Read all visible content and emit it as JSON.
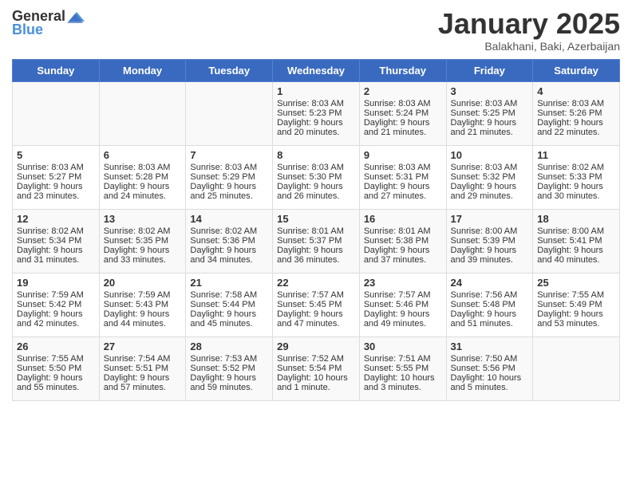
{
  "header": {
    "logo_general": "General",
    "logo_blue": "Blue",
    "month": "January 2025",
    "location": "Balakhani, Baki, Azerbaijan"
  },
  "days_of_week": [
    "Sunday",
    "Monday",
    "Tuesday",
    "Wednesday",
    "Thursday",
    "Friday",
    "Saturday"
  ],
  "weeks": [
    [
      {
        "day": "",
        "info": ""
      },
      {
        "day": "",
        "info": ""
      },
      {
        "day": "",
        "info": ""
      },
      {
        "day": "1",
        "info": "Sunrise: 8:03 AM\nSunset: 5:23 PM\nDaylight: 9 hours\nand 20 minutes."
      },
      {
        "day": "2",
        "info": "Sunrise: 8:03 AM\nSunset: 5:24 PM\nDaylight: 9 hours\nand 21 minutes."
      },
      {
        "day": "3",
        "info": "Sunrise: 8:03 AM\nSunset: 5:25 PM\nDaylight: 9 hours\nand 21 minutes."
      },
      {
        "day": "4",
        "info": "Sunrise: 8:03 AM\nSunset: 5:26 PM\nDaylight: 9 hours\nand 22 minutes."
      }
    ],
    [
      {
        "day": "5",
        "info": "Sunrise: 8:03 AM\nSunset: 5:27 PM\nDaylight: 9 hours\nand 23 minutes."
      },
      {
        "day": "6",
        "info": "Sunrise: 8:03 AM\nSunset: 5:28 PM\nDaylight: 9 hours\nand 24 minutes."
      },
      {
        "day": "7",
        "info": "Sunrise: 8:03 AM\nSunset: 5:29 PM\nDaylight: 9 hours\nand 25 minutes."
      },
      {
        "day": "8",
        "info": "Sunrise: 8:03 AM\nSunset: 5:30 PM\nDaylight: 9 hours\nand 26 minutes."
      },
      {
        "day": "9",
        "info": "Sunrise: 8:03 AM\nSunset: 5:31 PM\nDaylight: 9 hours\nand 27 minutes."
      },
      {
        "day": "10",
        "info": "Sunrise: 8:03 AM\nSunset: 5:32 PM\nDaylight: 9 hours\nand 29 minutes."
      },
      {
        "day": "11",
        "info": "Sunrise: 8:02 AM\nSunset: 5:33 PM\nDaylight: 9 hours\nand 30 minutes."
      }
    ],
    [
      {
        "day": "12",
        "info": "Sunrise: 8:02 AM\nSunset: 5:34 PM\nDaylight: 9 hours\nand 31 minutes."
      },
      {
        "day": "13",
        "info": "Sunrise: 8:02 AM\nSunset: 5:35 PM\nDaylight: 9 hours\nand 33 minutes."
      },
      {
        "day": "14",
        "info": "Sunrise: 8:02 AM\nSunset: 5:36 PM\nDaylight: 9 hours\nand 34 minutes."
      },
      {
        "day": "15",
        "info": "Sunrise: 8:01 AM\nSunset: 5:37 PM\nDaylight: 9 hours\nand 36 minutes."
      },
      {
        "day": "16",
        "info": "Sunrise: 8:01 AM\nSunset: 5:38 PM\nDaylight: 9 hours\nand 37 minutes."
      },
      {
        "day": "17",
        "info": "Sunrise: 8:00 AM\nSunset: 5:39 PM\nDaylight: 9 hours\nand 39 minutes."
      },
      {
        "day": "18",
        "info": "Sunrise: 8:00 AM\nSunset: 5:41 PM\nDaylight: 9 hours\nand 40 minutes."
      }
    ],
    [
      {
        "day": "19",
        "info": "Sunrise: 7:59 AM\nSunset: 5:42 PM\nDaylight: 9 hours\nand 42 minutes."
      },
      {
        "day": "20",
        "info": "Sunrise: 7:59 AM\nSunset: 5:43 PM\nDaylight: 9 hours\nand 44 minutes."
      },
      {
        "day": "21",
        "info": "Sunrise: 7:58 AM\nSunset: 5:44 PM\nDaylight: 9 hours\nand 45 minutes."
      },
      {
        "day": "22",
        "info": "Sunrise: 7:57 AM\nSunset: 5:45 PM\nDaylight: 9 hours\nand 47 minutes."
      },
      {
        "day": "23",
        "info": "Sunrise: 7:57 AM\nSunset: 5:46 PM\nDaylight: 9 hours\nand 49 minutes."
      },
      {
        "day": "24",
        "info": "Sunrise: 7:56 AM\nSunset: 5:48 PM\nDaylight: 9 hours\nand 51 minutes."
      },
      {
        "day": "25",
        "info": "Sunrise: 7:55 AM\nSunset: 5:49 PM\nDaylight: 9 hours\nand 53 minutes."
      }
    ],
    [
      {
        "day": "26",
        "info": "Sunrise: 7:55 AM\nSunset: 5:50 PM\nDaylight: 9 hours\nand 55 minutes."
      },
      {
        "day": "27",
        "info": "Sunrise: 7:54 AM\nSunset: 5:51 PM\nDaylight: 9 hours\nand 57 minutes."
      },
      {
        "day": "28",
        "info": "Sunrise: 7:53 AM\nSunset: 5:52 PM\nDaylight: 9 hours\nand 59 minutes."
      },
      {
        "day": "29",
        "info": "Sunrise: 7:52 AM\nSunset: 5:54 PM\nDaylight: 10 hours\nand 1 minute."
      },
      {
        "day": "30",
        "info": "Sunrise: 7:51 AM\nSunset: 5:55 PM\nDaylight: 10 hours\nand 3 minutes."
      },
      {
        "day": "31",
        "info": "Sunrise: 7:50 AM\nSunset: 5:56 PM\nDaylight: 10 hours\nand 5 minutes."
      },
      {
        "day": "",
        "info": ""
      }
    ]
  ]
}
